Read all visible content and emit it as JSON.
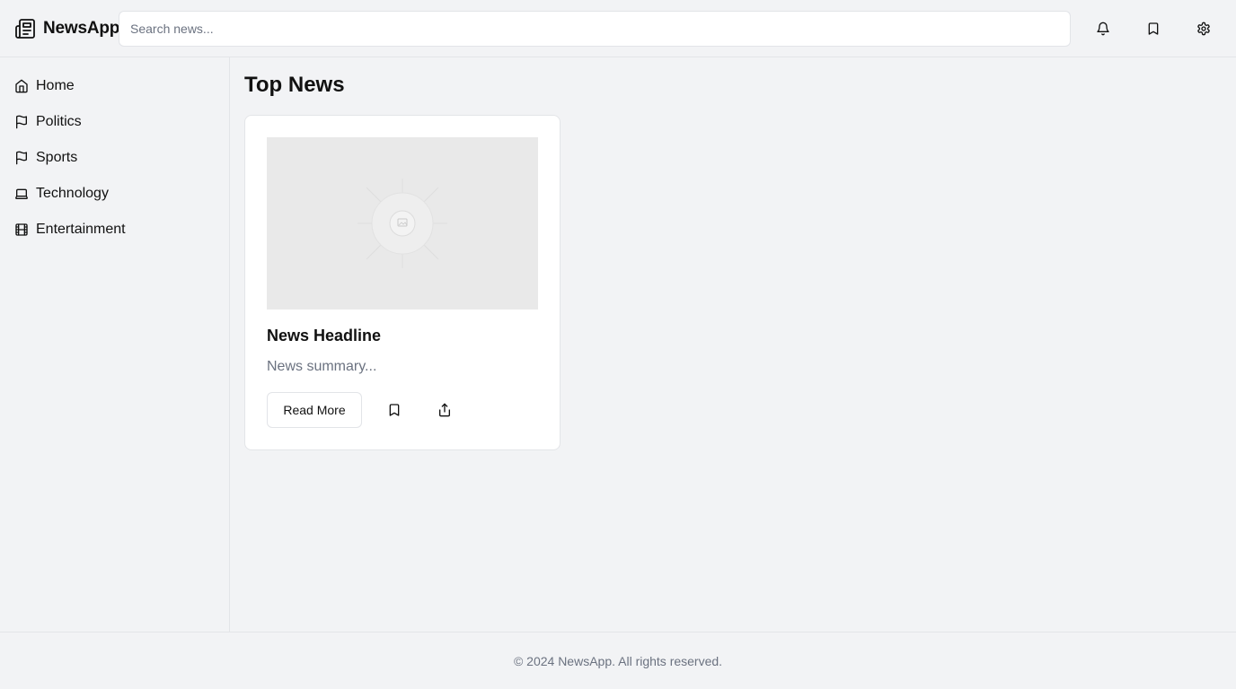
{
  "app": {
    "name": "NewsApp",
    "logo_icon": "newspaper-icon"
  },
  "header": {
    "search": {
      "placeholder": "Search news...",
      "value": ""
    },
    "actions": [
      {
        "icon": "bell-icon",
        "label": "Notifications"
      },
      {
        "icon": "bookmark-icon",
        "label": "Bookmarks"
      },
      {
        "icon": "gear-icon",
        "label": "Settings"
      }
    ]
  },
  "sidebar": {
    "items": [
      {
        "label": "Home",
        "icon": "home-icon"
      },
      {
        "label": "Politics",
        "icon": "flag-icon"
      },
      {
        "label": "Sports",
        "icon": "flag-icon"
      },
      {
        "label": "Technology",
        "icon": "laptop-icon"
      },
      {
        "label": "Entertainment",
        "icon": "film-icon"
      }
    ]
  },
  "main": {
    "title": "Top News",
    "articles": [
      {
        "image_icon": "image-placeholder-icon",
        "headline": "News Headline",
        "summary": "News summary...",
        "read_more_label": "Read More",
        "bookmark_icon": "bookmark-icon",
        "share_icon": "share-icon"
      }
    ]
  },
  "footer": {
    "text": "© 2024 NewsApp. All rights reserved."
  },
  "colors": {
    "background": "#f2f3f5",
    "surface": "#ffffff",
    "border": "#e3e5e8",
    "text": "#111111",
    "muted_text": "#6b7280",
    "placeholder_image": "#e9e9e9"
  }
}
